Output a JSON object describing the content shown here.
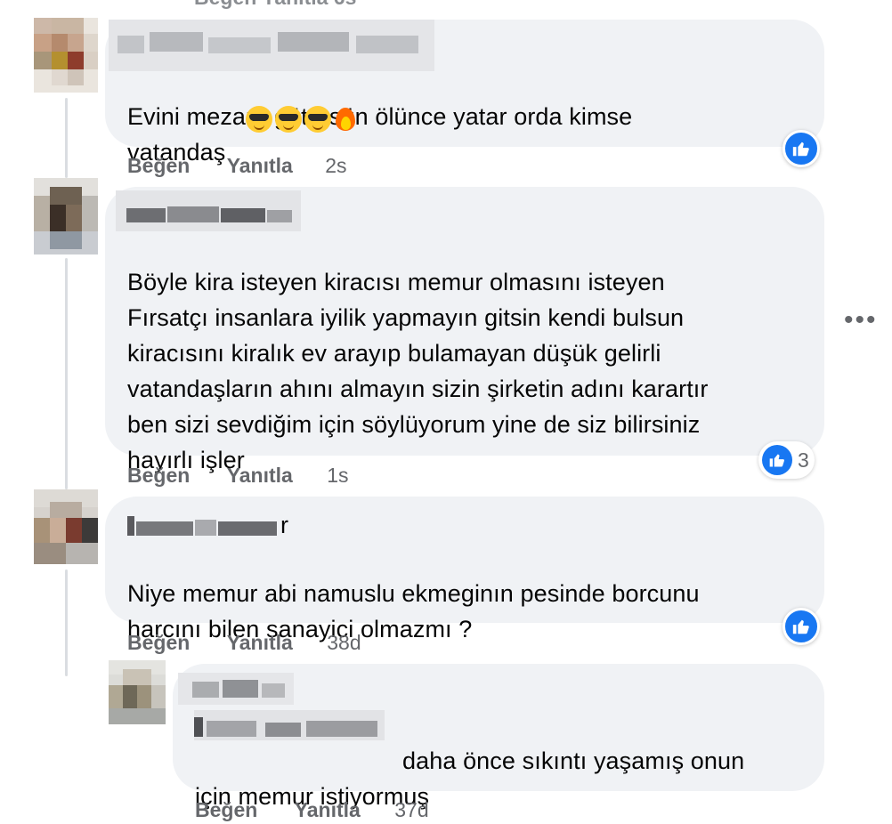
{
  "top_cut": {
    "actions": "Beğen   Yanıtla   6s"
  },
  "comments": [
    {
      "text": "Evini mezara götürsün ölünce yatar orda kimse\nvatandaş",
      "like_label": "Beğen",
      "reply_label": "Yanıtla",
      "time": "2s",
      "emojis": [
        "cool-emoji",
        "cool-emoji",
        "cool-emoji",
        "fire-emoji"
      ]
    },
    {
      "text": "Böyle kira isteyen kiracısı memur olmasını isteyen\nFırsatçı insanlara iyilik yapmayın gitsin kendi bulsun\nkiracısını kiralık ev arayıp bulamayan düşük gelirli\nvatandaşların ahını almayın sizin şirketin adını karartır\nben sizi sevdiğim için söylüyorum yine de siz bilirsiniz\nhayırlı işler",
      "like_label": "Beğen",
      "reply_label": "Yanıtla",
      "time": "1s",
      "reaction_count": "3"
    },
    {
      "name_tail": "r",
      "text": "Niye memur abi namuslu ekmeginın pesinde borcunu\nharcını bilen sanayici olmazmı ?",
      "like_label": "Beğen",
      "reply_label": "Yanıtla",
      "time": "38d"
    },
    {
      "text_line1": "daha önce sıkıntı yaşamış onun",
      "text_line2": "için memur istiyormuş",
      "like_label": "Beğen",
      "reply_label": "Yanıtla",
      "time": "37d"
    }
  ],
  "icons": {
    "like": "thumbs-up-icon",
    "more": "more-options-icon"
  },
  "colors": {
    "bubble": "#f0f2f5",
    "accent": "#1877f2",
    "meta": "#65676b"
  }
}
